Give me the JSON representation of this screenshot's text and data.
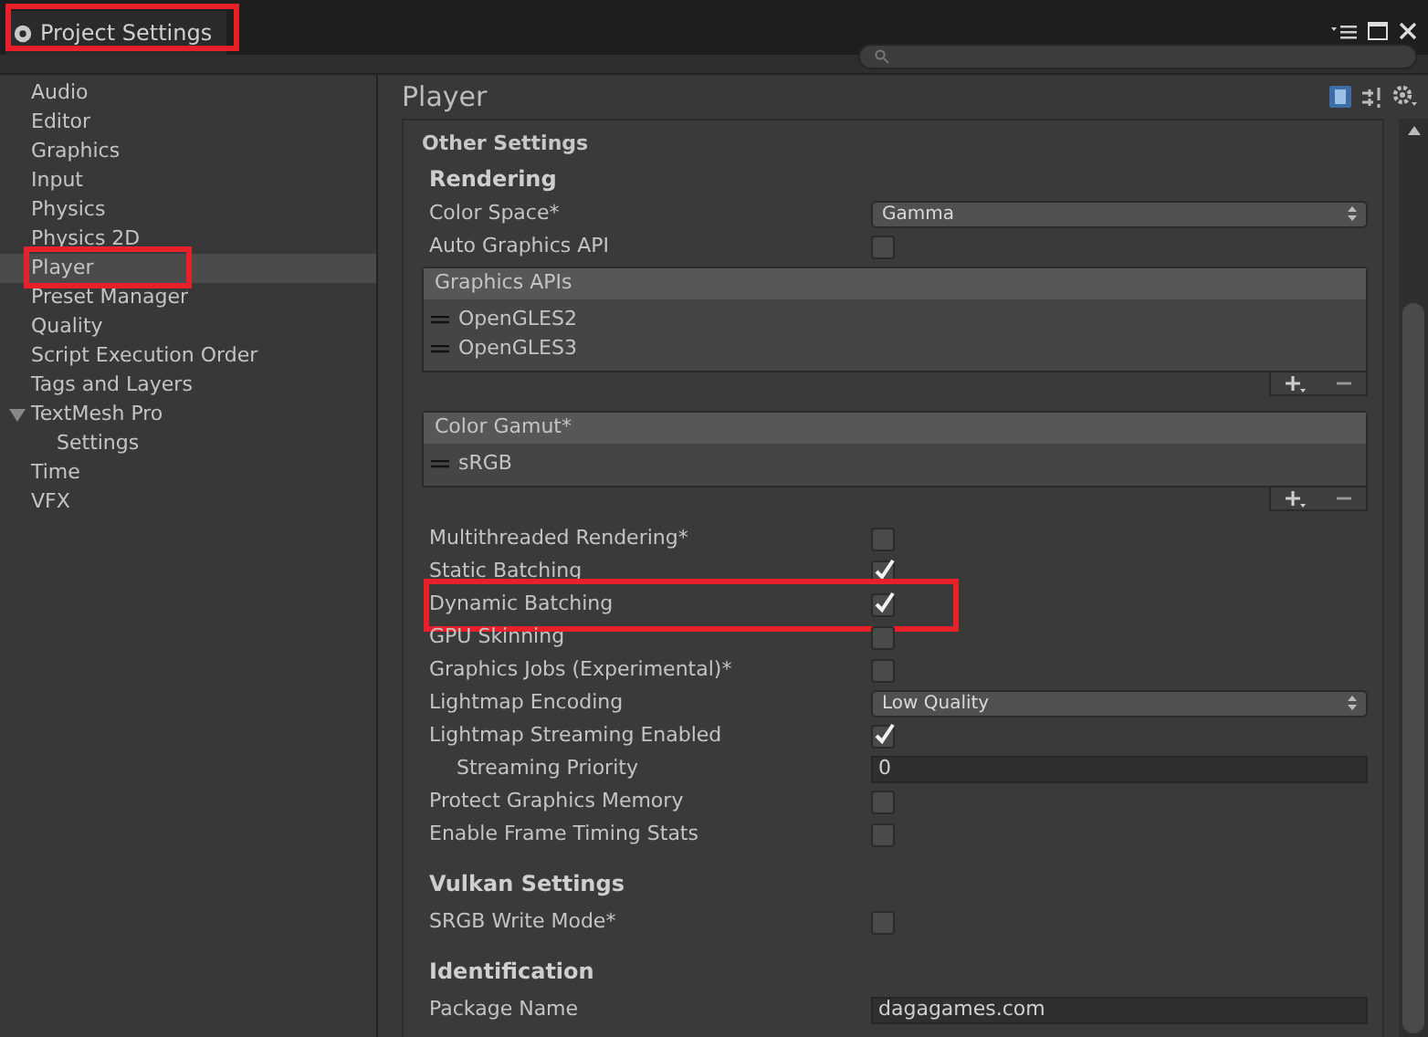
{
  "window": {
    "title": "Project Settings",
    "highlighted": true
  },
  "sidebar": {
    "items": [
      {
        "label": "Audio",
        "selected": false
      },
      {
        "label": "Editor",
        "selected": false
      },
      {
        "label": "Graphics",
        "selected": false
      },
      {
        "label": "Input",
        "selected": false
      },
      {
        "label": "Physics",
        "selected": false
      },
      {
        "label": "Physics 2D",
        "selected": false
      },
      {
        "label": "Player",
        "selected": true,
        "highlighted": true
      },
      {
        "label": "Preset Manager",
        "selected": false
      },
      {
        "label": "Quality",
        "selected": false
      },
      {
        "label": "Script Execution Order",
        "selected": false
      },
      {
        "label": "Tags and Layers",
        "selected": false
      },
      {
        "label": "TextMesh Pro",
        "selected": false,
        "expanded": true,
        "children": [
          {
            "label": "Settings",
            "selected": false
          }
        ]
      },
      {
        "label": "Time",
        "selected": false
      },
      {
        "label": "VFX",
        "selected": false
      }
    ]
  },
  "panel": {
    "title": "Player",
    "section": "Other Settings",
    "rows": [
      {
        "kind": "header",
        "label": "Rendering"
      },
      {
        "kind": "dropdown",
        "label": "Color Space*",
        "value": "Gamma"
      },
      {
        "kind": "checkbox",
        "label": "Auto Graphics API",
        "checked": false
      },
      {
        "kind": "list",
        "label": "Graphics APIs",
        "items": [
          "OpenGLES2",
          "OpenGLES3"
        ]
      },
      {
        "kind": "list",
        "label": "Color Gamut*",
        "items": [
          "sRGB"
        ]
      },
      {
        "kind": "checkbox",
        "label": "Multithreaded Rendering*",
        "checked": false
      },
      {
        "kind": "checkbox",
        "label": "Static Batching",
        "checked": true
      },
      {
        "kind": "checkbox",
        "label": "Dynamic Batching",
        "checked": true,
        "highlighted": true
      },
      {
        "kind": "checkbox",
        "label": "GPU Skinning",
        "checked": false
      },
      {
        "kind": "checkbox",
        "label": "Graphics Jobs (Experimental)*",
        "checked": false
      },
      {
        "kind": "dropdown",
        "label": "Lightmap Encoding",
        "value": "Low Quality"
      },
      {
        "kind": "checkbox",
        "label": "Lightmap Streaming Enabled",
        "checked": true
      },
      {
        "kind": "field",
        "label": "Streaming Priority",
        "value": "0",
        "indented": true
      },
      {
        "kind": "checkbox",
        "label": "Protect Graphics Memory",
        "checked": false
      },
      {
        "kind": "checkbox",
        "label": "Enable Frame Timing Stats",
        "checked": false
      },
      {
        "kind": "header",
        "label": "Vulkan Settings"
      },
      {
        "kind": "checkbox",
        "label": "SRGB Write Mode*",
        "checked": false
      },
      {
        "kind": "header",
        "label": "Identification"
      },
      {
        "kind": "field",
        "label": "Package Name",
        "value": "dagagames.com"
      }
    ]
  }
}
